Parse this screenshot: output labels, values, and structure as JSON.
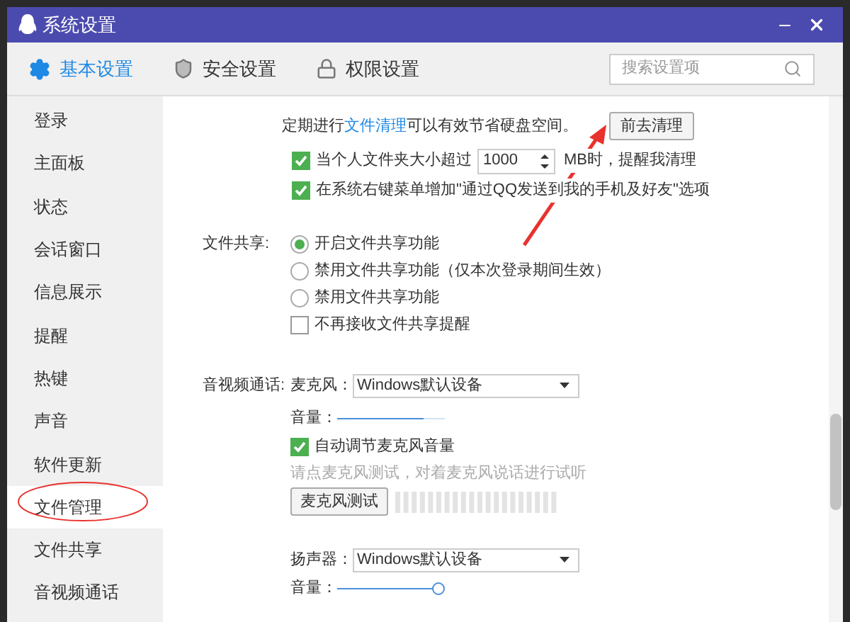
{
  "window": {
    "title": "系统设置"
  },
  "tabs": [
    {
      "label": "基本设置",
      "selected": true,
      "kind": "gear"
    },
    {
      "label": "安全设置",
      "selected": false,
      "kind": "shield"
    },
    {
      "label": "权限设置",
      "selected": false,
      "kind": "lock"
    }
  ],
  "search": {
    "placeholder": "搜索设置项"
  },
  "sidebar": {
    "items": [
      {
        "label": "登录",
        "selected": false
      },
      {
        "label": "主面板",
        "selected": false
      },
      {
        "label": "状态",
        "selected": false
      },
      {
        "label": "会话窗口",
        "selected": false
      },
      {
        "label": "信息展示",
        "selected": false
      },
      {
        "label": "提醒",
        "selected": false
      },
      {
        "label": "热键",
        "selected": false
      },
      {
        "label": "声音",
        "selected": false
      },
      {
        "label": "软件更新",
        "selected": false
      },
      {
        "label": "文件管理",
        "selected": true
      },
      {
        "label": "文件共享",
        "selected": false
      },
      {
        "label": "音视频通话",
        "selected": false
      }
    ]
  },
  "file_cleanup": {
    "text_before": "定期进行",
    "link": "文件清理",
    "text_after": "可以有效节省硬盘空间。",
    "button": "前去清理",
    "options": [
      {
        "label_before": "当个人文件夹大小超过",
        "value": "1000",
        "label_after": "MB时，提醒我清理",
        "checked": true
      },
      {
        "label": "在系统右键菜单增加\"通过QQ发送到我的手机及好友\"选项",
        "checked": true
      }
    ]
  },
  "file_sharing": {
    "label": "文件共享:",
    "options": [
      {
        "label": "开启文件共享功能",
        "selected": true
      },
      {
        "label": "禁用文件共享功能（仅本次登录期间生效）",
        "selected": false
      },
      {
        "label": "禁用文件共享功能",
        "selected": false
      }
    ],
    "no_reminder": {
      "label": "不再接收文件共享提醒",
      "checked": false
    }
  },
  "av_call": {
    "label": "音视频通话:",
    "microphone": {
      "label": "麦克风：",
      "device": "Windows默认设备",
      "volume_label": "音量：",
      "level": 0.8
    },
    "auto_adjust": {
      "label": "自动调节麦克风音量",
      "checked": true
    },
    "hint": "请点麦克风测试，对着麦克风说话进行试听",
    "test_button": "麦克风测试",
    "speaker": {
      "label": "扬声器：",
      "device": "Windows默认设备",
      "volume_label": "音量：",
      "level": 0.94
    }
  }
}
